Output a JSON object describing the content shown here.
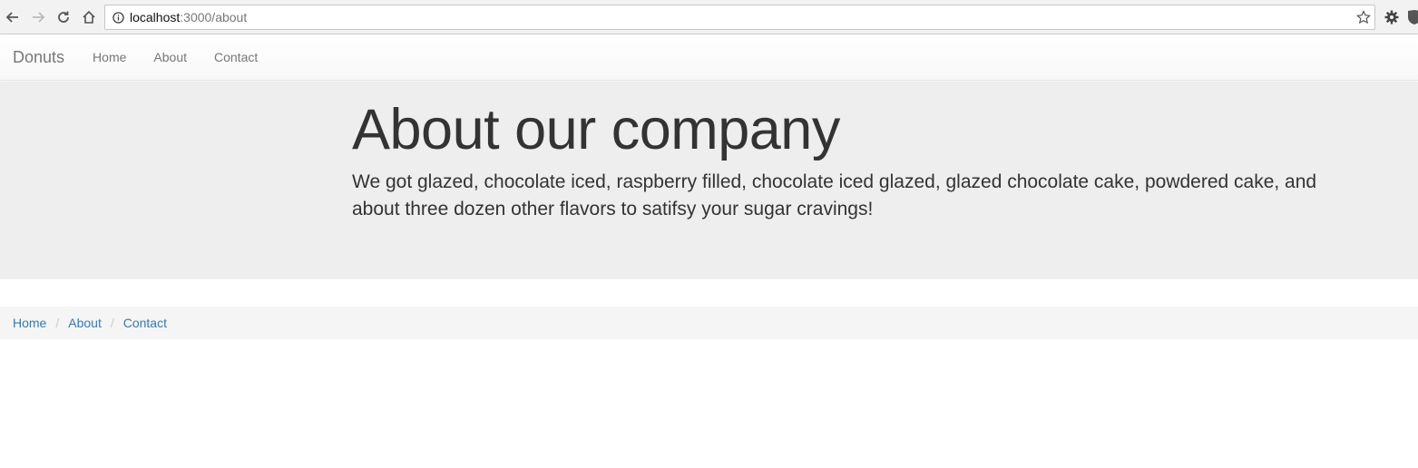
{
  "browser": {
    "url_host": "localhost",
    "url_path": ":3000/about"
  },
  "navbar": {
    "brand": "Donuts",
    "links": [
      "Home",
      "About",
      "Contact"
    ]
  },
  "jumbotron": {
    "title": "About our company",
    "text": "We got glazed, chocolate iced, raspberry filled, chocolate iced glazed, glazed chocolate cake, powdered cake, and about three dozen other flavors to satifsy your sugar cravings!"
  },
  "breadcrumb": {
    "items": [
      "Home",
      "About",
      "Contact"
    ],
    "separator": "/"
  },
  "colors": {
    "jumbotron_bg": "#eeeeee",
    "breadcrumb_bg": "#f5f5f5",
    "link": "#337ab7",
    "text": "#333333"
  }
}
